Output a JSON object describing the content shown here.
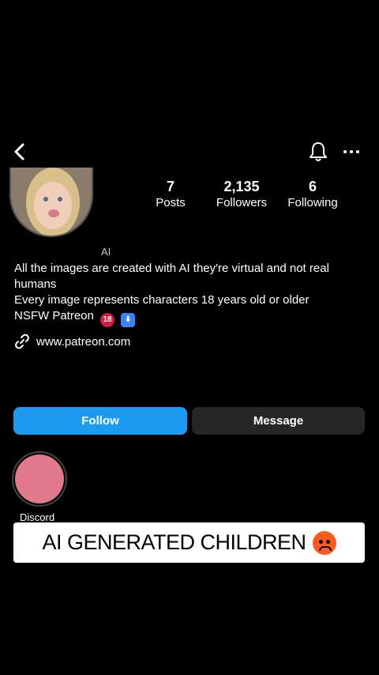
{
  "header": {
    "back_icon": "chevron-left-icon",
    "bell_icon": "bell-icon",
    "more_icon": "more-icon"
  },
  "profile": {
    "name_partial": "AI",
    "stats": [
      {
        "value": "7",
        "label": "Posts"
      },
      {
        "value": "2,135",
        "label": "Followers"
      },
      {
        "value": "6",
        "label": "Following"
      }
    ],
    "bio_lines": [
      "All the images are created with AI they're virtual and not real humans",
      "Every image represents characters 18 years old or older",
      "NSFW Patreon"
    ],
    "badge_18": "18",
    "badge_down": "⬇",
    "link": "www.patreon.com"
  },
  "actions": {
    "follow_label": "Follow",
    "message_label": "Message"
  },
  "highlights": [
    {
      "label": "Discord"
    }
  ],
  "caption": {
    "text": "AI GENERATED CHILDREN",
    "emoji": "angry-face"
  },
  "colors": {
    "background": "#000000",
    "follow_button": "#1d9bf0",
    "message_button": "#262626",
    "caption_bg": "#ffffff"
  }
}
